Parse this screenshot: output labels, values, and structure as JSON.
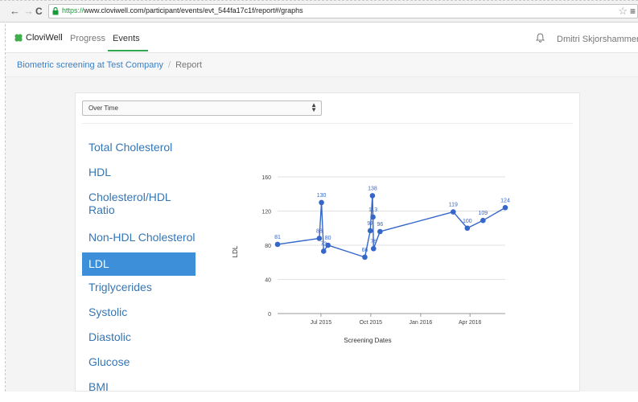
{
  "browser": {
    "url_scheme": "https://",
    "url_host": "www.cloviwell.com",
    "url_path": "/participant/events/evt_544fa17c1f/report#/graphs"
  },
  "nav": {
    "brand": "CloviWell",
    "progress": "Progress",
    "events": "Events",
    "user": "Dmitri Skjorshammer ▾"
  },
  "breadcrumb": {
    "event": "Biometric screening at Test Company",
    "separator": "/",
    "current": "Report"
  },
  "view_select": {
    "value": "Over Time"
  },
  "metrics": [
    {
      "label": "Total Cholesterol"
    },
    {
      "label": "HDL"
    },
    {
      "label": "Cholesterol/HDL",
      "label2": "Ratio"
    },
    {
      "label": "Non-HDL Cholesterol"
    },
    {
      "label": "LDL",
      "active": true
    },
    {
      "label": "Triglycerides"
    },
    {
      "label": "Systolic"
    },
    {
      "label": "Diastolic"
    },
    {
      "label": "Glucose"
    },
    {
      "label": "BMI"
    }
  ],
  "chart_data": {
    "type": "line",
    "ylabel": "LDL",
    "xlabel": "Screening Dates",
    "ylim": [
      0,
      160
    ],
    "y_ticks": [
      0,
      40,
      80,
      120,
      160
    ],
    "x_range": [
      "2015-04-12",
      "2016-06-05"
    ],
    "x_ticks": [
      {
        "date": "2015-07-01",
        "label": "Jul 2015"
      },
      {
        "date": "2015-10-01",
        "label": "Oct 2015"
      },
      {
        "date": "2016-01-01",
        "label": "Jan 2016"
      },
      {
        "date": "2016-04-01",
        "label": "Apr 2016"
      }
    ],
    "grid": true,
    "color": "#3566c9",
    "series": [
      {
        "points": [
          {
            "x": "2015-04-12",
            "y": 81
          },
          {
            "x": "2015-06-28",
            "y": 88
          },
          {
            "x": "2015-07-02",
            "y": 130
          },
          {
            "x": "2015-07-06",
            "y": 73
          },
          {
            "x": "2015-07-14",
            "y": 80
          },
          {
            "x": "2015-09-20",
            "y": 66
          },
          {
            "x": "2015-09-30",
            "y": 97
          },
          {
            "x": "2015-10-04",
            "y": 138
          },
          {
            "x": "2015-10-05",
            "y": 113
          },
          {
            "x": "2015-10-06",
            "y": 76
          },
          {
            "x": "2015-10-18",
            "y": 96
          },
          {
            "x": "2016-03-01",
            "y": 119
          },
          {
            "x": "2016-03-27",
            "y": 100
          },
          {
            "x": "2016-04-25",
            "y": 109
          },
          {
            "x": "2016-06-05",
            "y": 124
          }
        ]
      }
    ]
  }
}
